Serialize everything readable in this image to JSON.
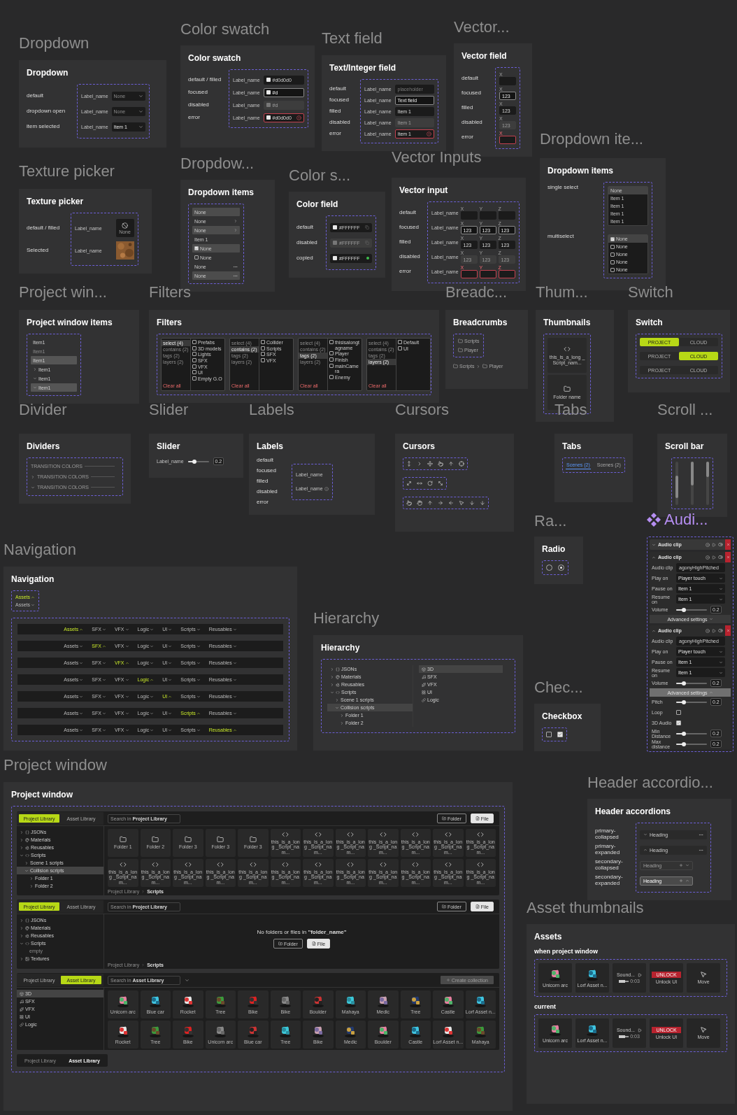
{
  "sections": [
    {
      "kind": "dropdown",
      "title": "Dropdown",
      "card_title": "Dropdown",
      "rows": [
        {
          "state": "default",
          "label": "Label_name",
          "value": "None",
          "muted": true
        },
        {
          "state": "dropdown open",
          "label": "Label_name",
          "value": "None",
          "muted": true
        },
        {
          "state": "item selected",
          "label": "Label_name",
          "value": "Item 1",
          "muted": false
        }
      ]
    },
    {
      "kind": "color_swatch",
      "title": "Color swatch",
      "card_title": "Color swatch",
      "rows": [
        {
          "state": "default / filled",
          "kind": "default",
          "label": "Label_name",
          "value": "#d0d0d0"
        },
        {
          "state": "focused",
          "kind": "focused",
          "label": "Label_name",
          "value": "#d"
        },
        {
          "state": "disabled",
          "kind": "disabled",
          "label": "Label_name",
          "value": "#d"
        },
        {
          "state": "error",
          "kind": "error",
          "label": "Label_name",
          "value": "#d0d0d0"
        }
      ]
    },
    {
      "kind": "text_field",
      "title": "Text field",
      "card_title": "Text/Integer field",
      "rows": [
        {
          "state": "default",
          "kind": "default",
          "label": "Label_name",
          "placeholder": "placeholder"
        },
        {
          "state": "focused",
          "kind": "focused",
          "label": "Label_name",
          "value": "Text field"
        },
        {
          "state": "filled",
          "kind": "filled",
          "label": "Label_name",
          "value": "Item 1"
        },
        {
          "state": "disabled",
          "kind": "disabled",
          "label": "Label_name",
          "value": "Item 1"
        },
        {
          "state": "error",
          "kind": "error",
          "label": "Label_name",
          "value": "Item 1"
        }
      ]
    },
    {
      "kind": "vector_field",
      "title": "Vector...",
      "card_title": "Vector field",
      "rows": [
        {
          "state": "default",
          "kind": "default",
          "axis": "X"
        },
        {
          "state": "focused",
          "kind": "focused",
          "axis": "X",
          "value": "123"
        },
        {
          "state": "filled",
          "kind": "filled",
          "axis": "X",
          "value": "123"
        },
        {
          "state": "disabled",
          "kind": "disabled",
          "axis": "X",
          "value": "123"
        },
        {
          "state": "error",
          "kind": "error",
          "axis": "X"
        }
      ]
    },
    {
      "kind": "texture_picker",
      "title": "Texture picker",
      "card_title": "Texture picker",
      "rows": [
        {
          "state": "default / filled",
          "label": "Label_name",
          "kind": "empty",
          "caption": "None"
        },
        {
          "state": "Selected",
          "label": "Label_name",
          "kind": "picture"
        }
      ]
    },
    {
      "kind": "menu",
      "title": "Dropdow...",
      "card_title": "Dropdown items",
      "items": [
        {
          "kind": "plain",
          "label": "None",
          "hovered": true
        },
        {
          "kind": "submenu",
          "label": "None",
          "hovered": false
        },
        {
          "kind": "submenu",
          "label": "None",
          "hovered": true
        },
        {
          "kind": "plain",
          "label": "Item 1",
          "hovered": false
        },
        {
          "kind": "check",
          "label": "None",
          "hovered": true,
          "checked": true
        },
        {
          "kind": "check",
          "label": "None",
          "hovered": false,
          "checked": false
        },
        {
          "kind": "more",
          "label": "None",
          "hovered": false
        },
        {
          "kind": "more",
          "label": "None",
          "hovered": true
        }
      ]
    },
    {
      "kind": "color_field",
      "title": "Color s...",
      "card_title": "Color field",
      "rows": [
        {
          "state": "default",
          "kind": "default",
          "value": "#FFFFFF"
        },
        {
          "state": "disabled",
          "kind": "disabled",
          "value": "#FFFFFF"
        },
        {
          "state": "copied",
          "kind": "copied",
          "value": "#FFFFFF"
        }
      ]
    },
    {
      "kind": "vector_input",
      "title": "Vector Inputs",
      "card_title": "Vector input",
      "rows": [
        {
          "state": "default",
          "kind": "default",
          "label": "Label_name",
          "axes": [
            {
              "axis": "X"
            },
            {
              "axis": "Y"
            },
            {
              "axis": "Z"
            }
          ]
        },
        {
          "state": "focused",
          "kind": "focused",
          "label": "Label_name",
          "axes": [
            {
              "axis": "X",
              "value": "123"
            },
            {
              "axis": "Y",
              "value": "123"
            },
            {
              "axis": "Z",
              "value": "123"
            }
          ]
        },
        {
          "state": "filled",
          "kind": "filled",
          "label": "Label_name",
          "axes": [
            {
              "axis": "X",
              "value": "123"
            },
            {
              "axis": "Y",
              "value": "123"
            },
            {
              "axis": "Z",
              "value": "123"
            }
          ]
        },
        {
          "state": "disabled",
          "kind": "disabled",
          "label": "Label_name",
          "axes": [
            {
              "axis": "X",
              "value": "123"
            },
            {
              "axis": "Y",
              "value": "123"
            },
            {
              "axis": "Z",
              "value": "123"
            }
          ]
        },
        {
          "state": "error",
          "kind": "error",
          "label": "Label_name",
          "axes": [
            {
              "axis": "X"
            },
            {
              "axis": "Y"
            },
            {
              "axis": "Z"
            }
          ]
        }
      ]
    },
    {
      "kind": "dropdown_select",
      "title": "Dropdown ite...",
      "card_title": "Dropdown items",
      "groups": [
        {
          "label": "single select",
          "kind": "single",
          "items": [
            {
              "label": "None",
              "selected": true
            },
            {
              "label": "Item 1",
              "selected": false
            },
            {
              "label": "Item 1",
              "selected": false
            },
            {
              "label": "Item 1",
              "selected": false
            },
            {
              "label": "Item 1",
              "selected": false
            }
          ]
        },
        {
          "label": "multiselect",
          "kind": "multi",
          "items": [
            {
              "label": "None",
              "checked": true
            },
            {
              "label": "None",
              "checked": false
            },
            {
              "label": "None",
              "checked": false
            },
            {
              "label": "None",
              "checked": false
            },
            {
              "label": "None",
              "checked": false
            }
          ]
        }
      ]
    },
    {
      "kind": "project_items",
      "title": "Project win...",
      "card_title": "Project window items",
      "items": [
        {
          "label": "Item1",
          "disabled": false,
          "selected": false
        },
        {
          "label": "Item1",
          "disabled": true,
          "selected": false
        },
        {
          "label": "Item1",
          "disabled": false,
          "selected": true
        },
        {
          "label": "Item1",
          "disabled": false,
          "selected": false,
          "expanded": false
        },
        {
          "label": "Item1",
          "disabled": false,
          "selected": false,
          "expanded": true
        },
        {
          "label": "Item1",
          "disabled": false,
          "selected": true,
          "expanded": true
        }
      ]
    },
    {
      "kind": "filters",
      "title": "Filters",
      "card_title": "Filters",
      "panels": [
        {
          "categories": [
            {
              "label": "select (4)",
              "selected": true
            },
            {
              "label": "contains (2)",
              "selected": false
            },
            {
              "label": "tags (2)",
              "selected": false
            },
            {
              "label": "layers (2)",
              "selected": false
            }
          ],
          "clear": "Clear all",
          "options": [
            {
              "label": "Prefabs",
              "checked": false
            },
            {
              "label": "3D models",
              "checked": false
            },
            {
              "label": "Lights",
              "checked": false
            },
            {
              "label": "SFX",
              "checked": false
            },
            {
              "label": "VFX",
              "checked": false
            },
            {
              "label": "UI",
              "checked": false
            },
            {
              "label": "Empty G.O",
              "checked": false
            }
          ]
        },
        {
          "categories": [
            {
              "label": "select (4)",
              "selected": false
            },
            {
              "label": "contains (2)",
              "selected": true
            },
            {
              "label": "tags (2)",
              "selected": false
            },
            {
              "label": "layers (2)",
              "selected": false
            }
          ],
          "clear": "Clear all",
          "options": [
            {
              "label": "Collider",
              "checked": false
            },
            {
              "label": "Scripts",
              "checked": false
            },
            {
              "label": "SFX",
              "checked": false
            },
            {
              "label": "VFX",
              "checked": false
            }
          ]
        },
        {
          "categories": [
            {
              "label": "select (4)",
              "selected": false
            },
            {
              "label": "contains (2)",
              "selected": false
            },
            {
              "label": "tags (2)",
              "selected": true
            },
            {
              "label": "layers (2)",
              "selected": false
            }
          ],
          "clear": "Clear all",
          "options": [
            {
              "label": "thisisalongtagname",
              "checked": false
            },
            {
              "label": "Player",
              "checked": false
            },
            {
              "label": "Finish",
              "checked": false
            },
            {
              "label": "mainCamera",
              "checked": false
            },
            {
              "label": "Enemy",
              "checked": false
            }
          ]
        },
        {
          "categories": [
            {
              "label": "select (4)",
              "selected": false
            },
            {
              "label": "contains (2)",
              "selected": false
            },
            {
              "label": "tags (2)",
              "selected": false
            },
            {
              "label": "layers (2)",
              "selected": true
            }
          ],
          "clear": "Clear all",
          "options": [
            {
              "label": "Default",
              "checked": false
            },
            {
              "label": "UI",
              "checked": false
            }
          ]
        }
      ]
    },
    {
      "kind": "breadcrumbs",
      "title": "Breadc...",
      "card_title": "Breadcrumbs",
      "items": [
        {
          "label": "Scripts"
        },
        {
          "label": "Player"
        }
      ],
      "path": [
        {
          "label": "Scripts"
        },
        {
          "label": "Player"
        }
      ]
    },
    {
      "kind": "thumbnails",
      "title": "Thum...",
      "card_title": "Thumbnails",
      "items": [
        {
          "kind": "script",
          "label": "this_is_a_long _Script_nam..."
        },
        {
          "kind": "folder",
          "label": "Folder name"
        }
      ]
    },
    {
      "kind": "switch",
      "title": "Switch",
      "card_title": "Switch",
      "rows": [
        {
          "options": [
            {
              "label": "PROJECT",
              "selected": true
            },
            {
              "label": "CLOUD",
              "selected": false
            }
          ]
        },
        {
          "options": [
            {
              "label": "PROJECT",
              "selected": false
            },
            {
              "label": "CLOUD",
              "selected": true
            }
          ]
        },
        {
          "options": [
            {
              "label": "PROJECT",
              "selected": false
            },
            {
              "label": "CLOUD",
              "selected": false
            }
          ]
        }
      ]
    },
    {
      "kind": "dividers",
      "title": "Divider",
      "card_title": "Dividers",
      "items": [
        {
          "label": "TRANSITION COLORS"
        },
        {
          "label": "TRANSITION COLORS",
          "expanded": false
        },
        {
          "label": "TRANSITION COLORS",
          "expanded": true
        }
      ]
    },
    {
      "kind": "slider",
      "title": "Slider",
      "card_title": "Slider",
      "label": "Label_name",
      "level": 0.3,
      "value": "0.2"
    },
    {
      "kind": "labels",
      "title": "Labels",
      "card_title": "Labels",
      "states": [
        "default",
        "focused",
        "filled",
        "disabled",
        "error"
      ],
      "samples": [
        {
          "label": "Label_name",
          "kind": "plain"
        },
        {
          "label": "Label_name",
          "kind": "info"
        }
      ]
    },
    {
      "kind": "cursors",
      "title": "Cursors",
      "card_title": "Cursors"
    },
    {
      "kind": "tabs",
      "title": "Tabs",
      "card_title": "Tabs",
      "tabs": [
        {
          "label": "Scenes (2)",
          "selected": true
        },
        {
          "label": "Scenes (2)",
          "selected": false
        }
      ]
    },
    {
      "kind": "scroll",
      "title": "Scroll ...",
      "card_title": "Scroll bar"
    },
    {
      "kind": "navigation",
      "title": "Navigation",
      "card_title": "Navigation",
      "compact": [
        {
          "label": "Assets",
          "selected": true
        },
        {
          "label": "Assets",
          "selected": false
        }
      ],
      "bars": [
        {
          "items": [
            {
              "label": "Assets",
              "selected": true
            },
            {
              "label": "SFX",
              "selected": false
            },
            {
              "label": "VFX",
              "selected": false
            },
            {
              "label": "Logic",
              "selected": false
            },
            {
              "label": "UI",
              "selected": false
            },
            {
              "label": "Scripts",
              "selected": false
            },
            {
              "label": "Reusables",
              "selected": false
            }
          ]
        },
        {
          "items": [
            {
              "label": "Assets",
              "selected": false
            },
            {
              "label": "SFX",
              "selected": true
            },
            {
              "label": "VFX",
              "selected": false
            },
            {
              "label": "Logic",
              "selected": false
            },
            {
              "label": "UI",
              "selected": false
            },
            {
              "label": "Scripts",
              "selected": false
            },
            {
              "label": "Reusables",
              "selected": false
            }
          ]
        },
        {
          "items": [
            {
              "label": "Assets",
              "selected": false
            },
            {
              "label": "SFX",
              "selected": false
            },
            {
              "label": "VFX",
              "selected": true
            },
            {
              "label": "Logic",
              "selected": false
            },
            {
              "label": "UI",
              "selected": false
            },
            {
              "label": "Scripts",
              "selected": false
            },
            {
              "label": "Reusables",
              "selected": false
            }
          ]
        },
        {
          "items": [
            {
              "label": "Assets",
              "selected": false
            },
            {
              "label": "SFX",
              "selected": false
            },
            {
              "label": "VFX",
              "selected": false
            },
            {
              "label": "Logic",
              "selected": true
            },
            {
              "label": "UI",
              "selected": false
            },
            {
              "label": "Scripts",
              "selected": false
            },
            {
              "label": "Reusables",
              "selected": false
            }
          ]
        },
        {
          "items": [
            {
              "label": "Assets",
              "selected": false
            },
            {
              "label": "SFX",
              "selected": false
            },
            {
              "label": "VFX",
              "selected": false
            },
            {
              "label": "Logic",
              "selected": false
            },
            {
              "label": "UI",
              "selected": true
            },
            {
              "label": "Scripts",
              "selected": false
            },
            {
              "label": "Reusables",
              "selected": false
            }
          ]
        },
        {
          "items": [
            {
              "label": "Assets",
              "selected": false
            },
            {
              "label": "SFX",
              "selected": false
            },
            {
              "label": "VFX",
              "selected": false
            },
            {
              "label": "Logic",
              "selected": false
            },
            {
              "label": "UI",
              "selected": false
            },
            {
              "label": "Scripts",
              "selected": true
            },
            {
              "label": "Reusables",
              "selected": false
            }
          ]
        },
        {
          "items": [
            {
              "label": "Assets",
              "selected": false
            },
            {
              "label": "SFX",
              "selected": false
            },
            {
              "label": "VFX",
              "selected": false
            },
            {
              "label": "Logic",
              "selected": false
            },
            {
              "label": "UI",
              "selected": false
            },
            {
              "label": "Scripts",
              "selected": false
            },
            {
              "label": "Reusables",
              "selected": true
            }
          ]
        }
      ]
    },
    {
      "kind": "hierarchy",
      "title": "Hierarchy",
      "card_title": "Hierarchy",
      "tree": [
        {
          "label": "JSONs",
          "kind": "json",
          "expanded": false,
          "selected": false
        },
        {
          "label": "Materials",
          "kind": "material",
          "expanded": false,
          "selected": false
        },
        {
          "label": "Reusables",
          "kind": "reusable",
          "expanded": false,
          "selected": false
        },
        {
          "label": "Scripts",
          "kind": "script",
          "expanded": true,
          "selected": false,
          "children": [
            {
              "label": "Scene 1 scripts",
              "expanded": false,
              "selected": false
            },
            {
              "label": "Collision scripts",
              "expanded": true,
              "selected": true,
              "children": [
                {
                  "label": "Folder 1",
                  "expanded": false,
                  "selected": false
                },
                {
                  "label": "Folder 2",
                  "expanded": false,
                  "selected": false
                }
              ]
            }
          ]
        }
      ],
      "list": [
        {
          "label": "3D",
          "kind": "models",
          "selected": true
        },
        {
          "label": "SFX",
          "kind": "sfx",
          "selected": false
        },
        {
          "label": "VFX",
          "kind": "vfx",
          "selected": false
        },
        {
          "label": "UI",
          "kind": "ui",
          "selected": false
        },
        {
          "label": "Logic",
          "kind": "logic",
          "selected": false
        }
      ]
    },
    {
      "kind": "radio",
      "title": "Ra...",
      "card_title": "Radio",
      "radios": [
        {
          "selected": false
        },
        {
          "selected": true
        }
      ]
    },
    {
      "kind": "checkbox",
      "title": "Chec...",
      "card_title": "Checkbox",
      "boxes": [
        {
          "checked": false
        },
        {
          "checked": true
        }
      ]
    },
    {
      "kind": "audio",
      "title": "Audi...",
      "clips": [
        {
          "title": "Audio clip",
          "expanded": false
        },
        {
          "title": "Audio clip",
          "expanded": true,
          "fields": [
            {
              "kind": "text",
              "label": "Audio clip",
              "value": "agonyHighPitched"
            },
            {
              "kind": "select",
              "label": "Play on",
              "value": "Player touch"
            },
            {
              "kind": "select",
              "label": "Pause on",
              "value": "Item 1"
            },
            {
              "kind": "select",
              "label": "Resume on",
              "value": "Item 1"
            },
            {
              "kind": "slider",
              "label": "Volume",
              "level": 0.25,
              "value": "0.2"
            }
          ],
          "advanced": {
            "label": "Advanced settings",
            "expanded": false
          }
        },
        {
          "title": "Audio clip",
          "expanded": true,
          "fields": [
            {
              "kind": "text",
              "label": "Audio clip",
              "value": "agonyHighPitched"
            },
            {
              "kind": "select",
              "label": "Play on",
              "value": "Player touch"
            },
            {
              "kind": "select",
              "label": "Pause on",
              "value": "Item 1"
            },
            {
              "kind": "select",
              "label": "Resume on",
              "value": "Item 1"
            },
            {
              "kind": "slider",
              "label": "Volume",
              "level": 0.25,
              "value": "0.2"
            }
          ],
          "advanced": {
            "label": "Advanced settings",
            "expanded": true,
            "fields": [
              {
                "kind": "slider",
                "label": "Pitch",
                "level": 0.25,
                "value": "0.2"
              },
              {
                "kind": "checkbox",
                "label": "Loop",
                "checked": false
              },
              {
                "kind": "checkbox",
                "label": "3D Audio",
                "checked": true
              },
              {
                "kind": "slider",
                "label": "Min Distance",
                "level": 0.25,
                "value": "0.2"
              },
              {
                "kind": "slider",
                "label": "Max distance",
                "level": 0.25,
                "value": "0.2"
              }
            ]
          }
        }
      ]
    },
    {
      "kind": "project_window",
      "title": "Project window",
      "card_title": "Project window",
      "windows": [
        {
          "kind": "grid",
          "tabs": [
            {
              "label": "Project Library",
              "selected": true
            },
            {
              "label": "Asset Library",
              "selected": false
            }
          ],
          "search": {
            "placeholder": "Search in **Project Library**"
          },
          "buttons": [
            {
              "kind": "folder",
              "label": "Folder"
            },
            {
              "kind": "file",
              "label": "File"
            }
          ],
          "tree": [
            {
              "label": "JSONs",
              "kind": "json",
              "expanded": false,
              "selected": false
            },
            {
              "label": "Materials",
              "kind": "material",
              "expanded": false,
              "selected": false
            },
            {
              "label": "Reusables",
              "kind": "reusable",
              "expanded": false,
              "selected": false
            },
            {
              "label": "Scripts",
              "kind": "script",
              "expanded": true,
              "selected": false,
              "children": [
                {
                  "label": "Scene 1 scripts",
                  "expanded": false,
                  "selected": false
                },
                {
                  "label": "Collision scripts",
                  "expanded": true,
                  "selected": true,
                  "children": [
                    {
                      "label": "Folder 1",
                      "expanded": false,
                      "selected": false
                    },
                    {
                      "label": "Folder 2",
                      "expanded": false,
                      "selected": false
                    }
                  ]
                }
              ]
            }
          ],
          "items": [
            {
              "kind": "folder",
              "label": "Folder 1"
            },
            {
              "kind": "folder",
              "label": "Folder 2"
            },
            {
              "kind": "folder",
              "label": "Folder 3"
            },
            {
              "kind": "folder",
              "label": "Folder 3"
            },
            {
              "kind": "folder",
              "label": "Folder 3"
            },
            {
              "kind": "script",
              "label": "this_is_a_long _Script_nam..."
            },
            {
              "kind": "script",
              "label": "this_is_a_long _Script_nam..."
            },
            {
              "kind": "script",
              "label": "this_is_a_long _Script_nam..."
            },
            {
              "kind": "script",
              "label": "this_is_a_long _Script_nam..."
            },
            {
              "kind": "script",
              "label": "this_is_a_long _Script_nam..."
            },
            {
              "kind": "script",
              "label": "this_is_a_long _Script_nam..."
            },
            {
              "kind": "script",
              "label": "this_is_a_long _Script_nam..."
            },
            {
              "kind": "script",
              "label": "this_is_a_long _Script_nam..."
            },
            {
              "kind": "script",
              "label": "this_is_a_long _Script_nam..."
            },
            {
              "kind": "script",
              "label": "this_is_a_long _Script_nam..."
            },
            {
              "kind": "script",
              "label": "this_is_a_long _Script_nam..."
            },
            {
              "kind": "script",
              "label": "this_is_a_long _Script_nam..."
            },
            {
              "kind": "script",
              "label": "this_is_a_long _Script_nam..."
            },
            {
              "kind": "script",
              "label": "this_is_a_long _Script_nam..."
            },
            {
              "kind": "script",
              "label": "this_is_a_long _Script_nam..."
            },
            {
              "kind": "script",
              "label": "this_is_a_long _Script_nam..."
            },
            {
              "kind": "script",
              "label": "this_is_a_long _Script_nam..."
            },
            {
              "kind": "script",
              "label": "this_is_a_long _Script_nam..."
            },
            {
              "kind": "script",
              "label": "this_is_a_long _Script_nam..."
            }
          ],
          "path": [
            "Project Library",
            "Scripts"
          ]
        },
        {
          "kind": "empty",
          "tabs": [
            {
              "label": "Project Library",
              "selected": true
            },
            {
              "label": "Asset Library",
              "selected": false
            }
          ],
          "search": {
            "placeholder": "Search in **Project Library**"
          },
          "buttons": [
            {
              "kind": "folder",
              "label": "Folder"
            },
            {
              "kind": "file",
              "label": "File"
            }
          ],
          "tree": [
            {
              "label": "JSONs",
              "kind": "json",
              "expanded": false,
              "selected": false
            },
            {
              "label": "Materials",
              "kind": "material",
              "expanded": false,
              "selected": false
            },
            {
              "label": "Reusables",
              "kind": "reusable",
              "expanded": false,
              "selected": false
            },
            {
              "label": "Scripts",
              "kind": "script",
              "expanded": true,
              "selected": false,
              "children": [
                {
                  "label": "empty",
                  "kind": "empty",
                  "selected": false
                }
              ]
            },
            {
              "label": "Textures",
              "kind": "texture",
              "expanded": false,
              "selected": false
            }
          ],
          "message": "No folders or files in **\"folder_name\"**",
          "empty_buttons": [
            {
              "kind": "folder",
              "label": "Folder"
            },
            {
              "kind": "file",
              "label": "File"
            }
          ],
          "path": [
            "Project Library",
            "Scripts"
          ]
        },
        {
          "kind": "assets",
          "tabs": [
            {
              "label": "Project Library",
              "selected": false
            },
            {
              "label": "Asset Library",
              "selected": true
            }
          ],
          "search": {
            "placeholder": "Search in **Asset Library**"
          },
          "action": {
            "label": "Create collection",
            "disabled": true
          },
          "list": [
            {
              "label": "3D",
              "kind": "models",
              "selected": true
            },
            {
              "label": "SFX",
              "kind": "sfx",
              "selected": false
            },
            {
              "label": "VFX",
              "kind": "vfx",
              "selected": false
            },
            {
              "label": "UI",
              "kind": "ui",
              "selected": false
            },
            {
              "label": "Logic",
              "kind": "logic",
              "selected": false
            }
          ],
          "items": [
            {
              "label": "Unicorn arc"
            },
            {
              "label": "Blue car"
            },
            {
              "label": "Rocket"
            },
            {
              "label": "Tree"
            },
            {
              "label": "Bike"
            },
            {
              "label": "Bike"
            },
            {
              "label": "Boulder"
            },
            {
              "label": "Mahaya"
            },
            {
              "label": "Medic"
            },
            {
              "label": "Tree"
            },
            {
              "label": "Castle"
            },
            {
              "label": "Lorf Asset n..."
            },
            {
              "label": "Rocket"
            },
            {
              "label": "Tree"
            },
            {
              "label": "Bike"
            },
            {
              "label": "Unicorn arc"
            },
            {
              "label": "Blue car"
            },
            {
              "label": "Tree"
            },
            {
              "label": "Bike"
            },
            {
              "label": "Medic"
            },
            {
              "label": "Boulder"
            },
            {
              "label": "Castle"
            },
            {
              "label": "Lorf Asset n..."
            },
            {
              "label": "Mahaya"
            }
          ]
        }
      ],
      "footer_tabs": [
        {
          "label": "Project Library",
          "selected": false
        },
        {
          "label": "Asset Library",
          "selected": true
        }
      ]
    },
    {
      "kind": "header_accordions",
      "title": "Header accordio...",
      "card_title": "Header accordions",
      "rows": [
        {
          "state": "primary-collapsed",
          "kind": "primary",
          "heading": "Heading",
          "expanded": false
        },
        {
          "state": "primary-expanded",
          "kind": "primary",
          "heading": "Heading",
          "expanded": true
        },
        {
          "state": "secondary-collapsed",
          "kind": "secondary",
          "heading": "Heading",
          "expanded": false
        },
        {
          "state": "secondary-expanded",
          "kind": "secondary",
          "heading": "Heading",
          "expanded": true
        }
      ]
    },
    {
      "kind": "asset_thumbnails",
      "title": "Asset thumbnails",
      "card_title": "Assets",
      "groups": [
        {
          "label": "when project window",
          "tiles": [
            {
              "kind": "model",
              "label": "Unicorn arc"
            },
            {
              "kind": "model",
              "label": "Lorf Asset n..."
            },
            {
              "kind": "sound",
              "label": "Sound...",
              "time": "0:03"
            },
            {
              "kind": "ui",
              "badge": "UNLOCK",
              "label": "Unlock UI"
            },
            {
              "kind": "tool",
              "label": "Move"
            }
          ]
        },
        {
          "label": "current",
          "tiles": [
            {
              "kind": "model",
              "label": "Unicorn arc"
            },
            {
              "kind": "model",
              "label": "Lorf Asset n..."
            },
            {
              "kind": "sound",
              "label": "Sound...",
              "time": "0:03"
            },
            {
              "kind": "ui",
              "badge": "UNLOCK",
              "label": "Unlock UI"
            },
            {
              "kind": "tool",
              "label": "Move"
            }
          ]
        }
      ]
    }
  ]
}
